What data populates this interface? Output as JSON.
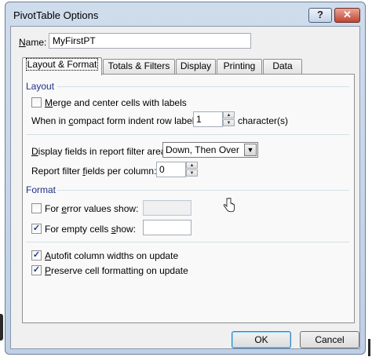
{
  "window": {
    "title": "PivotTable Options",
    "help_label": "?",
    "close_label": "✕"
  },
  "name": {
    "label_prefix": "N",
    "label_rest": "ame:",
    "value": "MyFirstPT"
  },
  "tabs": [
    {
      "label": "Layout & Format",
      "active": true
    },
    {
      "label": "Totals & Filters",
      "active": false
    },
    {
      "label": "Display",
      "active": false
    },
    {
      "label": "Printing",
      "active": false
    },
    {
      "label": "Data",
      "active": false
    }
  ],
  "layout": {
    "section_title": "Layout",
    "merge_center": {
      "label_u": "M",
      "label_rest": "erge and center cells with labels",
      "checked": false
    },
    "indent": {
      "label_a": "When in ",
      "label_u": "c",
      "label_b": "ompact form indent row labels:",
      "value": "1",
      "suffix": "character(s)"
    },
    "filter_area": {
      "label_u": "D",
      "label_rest": "isplay fields in report filter area:",
      "value": "Down, Then Over"
    },
    "filter_per_column": {
      "label_a": "Report filter ",
      "label_u": "f",
      "label_b": "ields per column:",
      "value": "0"
    }
  },
  "format": {
    "section_title": "Format",
    "error_values": {
      "label_a": "For ",
      "label_u": "e",
      "label_b": "rror values show:",
      "checked": false,
      "value": ""
    },
    "empty_cells": {
      "label_a": "For empty cells ",
      "label_u": "s",
      "label_b": "how:",
      "checked": true,
      "value": ""
    },
    "autofit": {
      "label_u": "A",
      "label_rest": "utofit column widths on update",
      "checked": true
    },
    "preserve": {
      "label_u": "P",
      "label_rest": "reserve cell formatting on update",
      "checked": true
    }
  },
  "buttons": {
    "ok": "OK",
    "cancel": "Cancel"
  },
  "icons": {
    "cursor": "hand-pointer-icon",
    "check": "✓"
  }
}
